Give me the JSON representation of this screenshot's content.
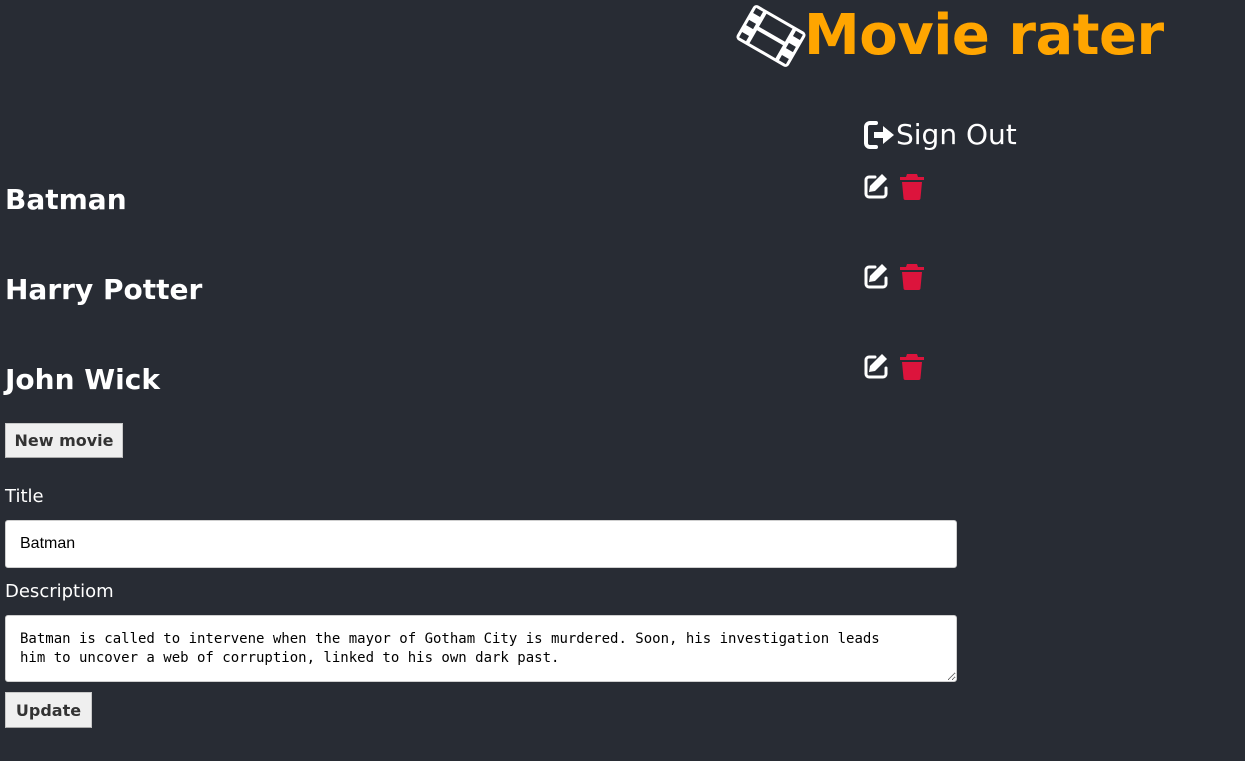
{
  "header": {
    "app_title": "Movie rater",
    "logo_icon": "film-icon",
    "title_color": "#ffa500"
  },
  "auth": {
    "sign_out_label": "Sign Out",
    "sign_out_icon": "sign-out-icon"
  },
  "movies": [
    {
      "title": "Batman",
      "edit_icon": "edit-icon",
      "delete_icon": "trash-icon"
    },
    {
      "title": "Harry Potter",
      "edit_icon": "edit-icon",
      "delete_icon": "trash-icon"
    },
    {
      "title": "John Wick",
      "edit_icon": "edit-icon",
      "delete_icon": "trash-icon"
    }
  ],
  "actions": {
    "new_movie_label": "New movie",
    "update_label": "Update"
  },
  "form": {
    "title_label": "Title",
    "title_value": "Batman",
    "description_label": "Descriptiom",
    "description_value": "Batman is called to intervene when the mayor of Gotham City is murdered. Soon, his investigation leads\nhim to uncover a web of corruption, linked to his own dark past."
  },
  "colors": {
    "background": "#282c34",
    "accent": "#ffa500",
    "delete": "#dc143c",
    "text": "#ffffff"
  }
}
